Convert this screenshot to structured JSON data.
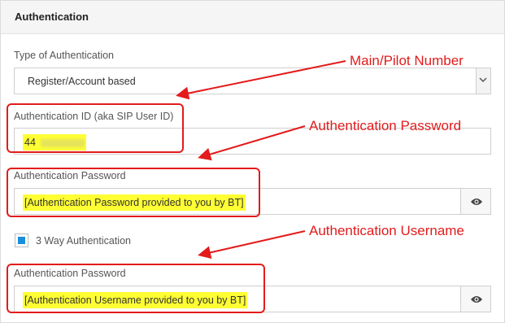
{
  "panel": {
    "title": "Authentication"
  },
  "fields": {
    "auth_type": {
      "label": "Type of Authentication",
      "value": "Register/Account based"
    },
    "auth_id": {
      "label": "Authentication ID (aka SIP User ID)",
      "value": "44"
    },
    "auth_password": {
      "label": "Authentication Password",
      "value": "[Authentication Password provided to you by BT]"
    },
    "three_way": {
      "label": "3 Way Authentication",
      "checked": true
    },
    "auth_password_2": {
      "label": "Authentication Password",
      "value": "[Authentication Username provided to you by BT]"
    }
  },
  "annotations": {
    "main_pilot": "Main/Pilot Number",
    "auth_password": "Authentication Password",
    "auth_username": "Authentication Username",
    "color": "#e31b1b"
  },
  "icons": {
    "dropdown": "chevron-down-icon",
    "reveal": "eye-icon"
  },
  "colors": {
    "highlight": "#ffff33",
    "checkbox": "#1a8fd9"
  }
}
